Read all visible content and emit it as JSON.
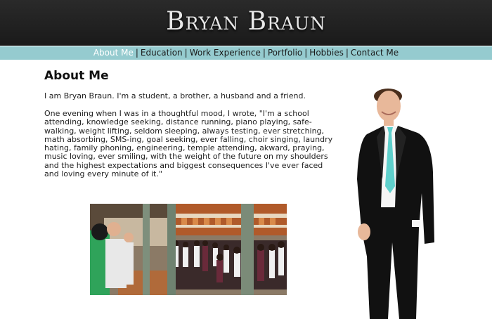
{
  "site": {
    "title": "Bryan Braun"
  },
  "nav": {
    "items": [
      {
        "label": "About Me",
        "active": true
      },
      {
        "label": "Education"
      },
      {
        "label": "Work Experience"
      },
      {
        "label": "Portfolio"
      },
      {
        "label": "Hobbies"
      },
      {
        "label": "Contact Me"
      }
    ],
    "separator": "|"
  },
  "main": {
    "heading": "About Me",
    "intro": "I am Bryan Braun. I'm a student, a brother, a husband and a friend.",
    "quote": "One evening when I was in a thoughtful mood, I wrote, \"I'm a school attending, knowledge seeking, distance running, piano playing, safe-walking, weight lifting, seldom sleeping, always testing, ever stretching, math absorbing, SMS-ing, goal seeking, ever falling, choir singing, laundry hating, family phoning, engineering, temple attending, akward, praying, music loving, ever smiling, with the weight of the future on my shoulders and the highest expectations and biggest consequences I've ever faced and loving every minute of it.\""
  },
  "colors": {
    "header_bg": "#1f1f1f",
    "nav_bg": "#95cbcf",
    "nav_active": "#ffffff",
    "tie": "#5fd0cc"
  },
  "images": {
    "group_photo": "school-assembly-photo",
    "portrait": "bryan-portrait"
  }
}
